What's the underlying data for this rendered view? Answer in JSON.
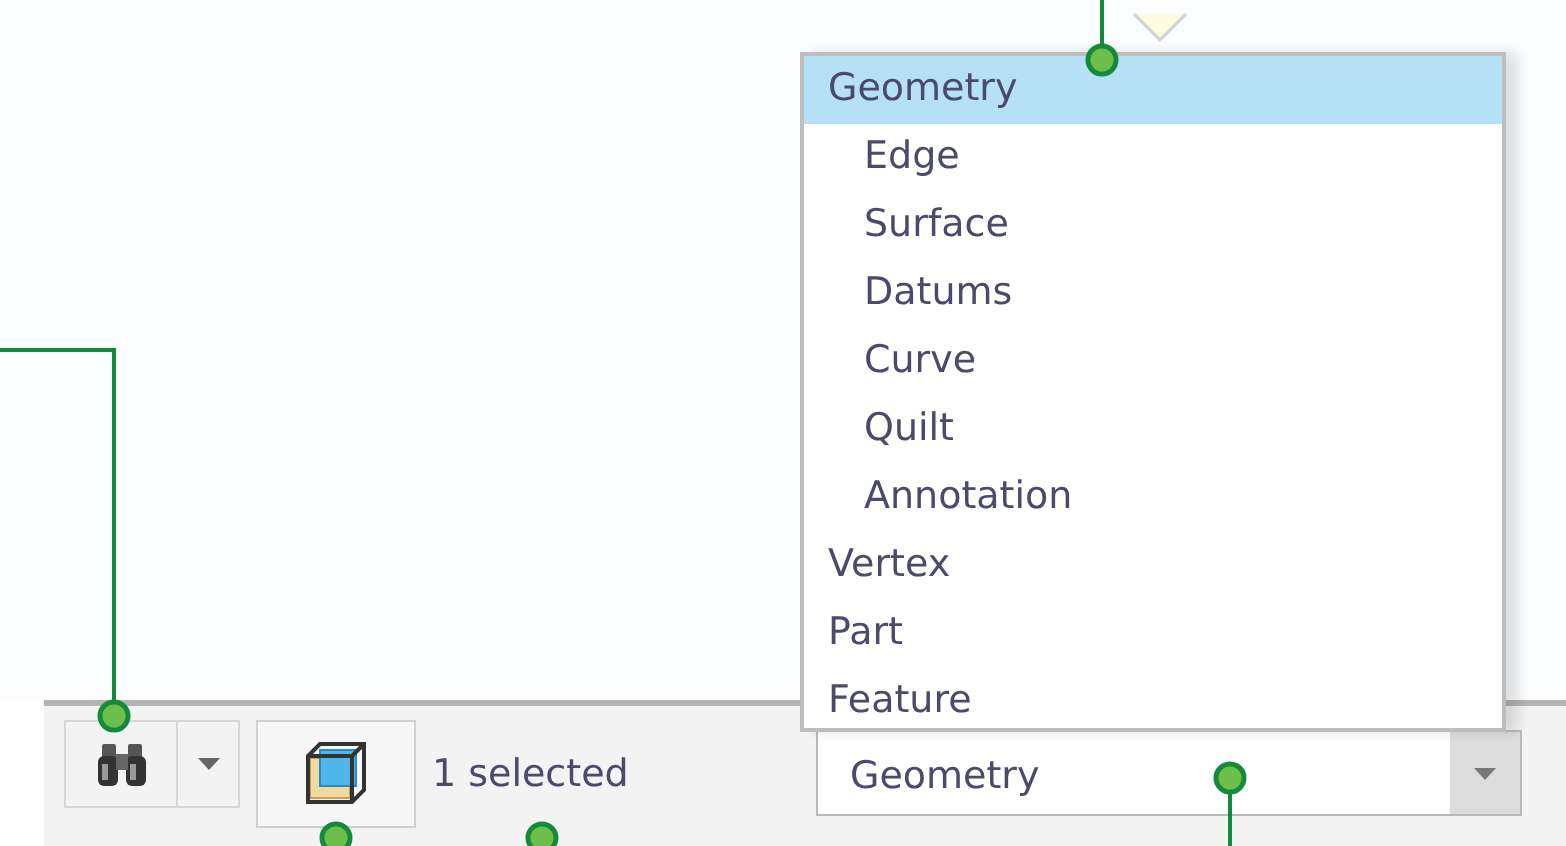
{
  "filter_list": {
    "items": [
      {
        "label": "Geometry",
        "selected": true,
        "children": [
          {
            "label": "Edge",
            "selected": false
          },
          {
            "label": "Surface",
            "selected": false
          },
          {
            "label": "Datums",
            "selected": false
          },
          {
            "label": "Curve",
            "selected": false
          },
          {
            "label": "Quilt",
            "selected": false
          },
          {
            "label": "Annotation",
            "selected": false
          }
        ]
      },
      {
        "label": "Vertex",
        "selected": false
      },
      {
        "label": "Part",
        "selected": false
      },
      {
        "label": "Feature",
        "selected": false
      }
    ]
  },
  "status_bar": {
    "selection_count": "1 selected",
    "filter_combo": {
      "value": "Geometry",
      "expanded": true
    }
  }
}
